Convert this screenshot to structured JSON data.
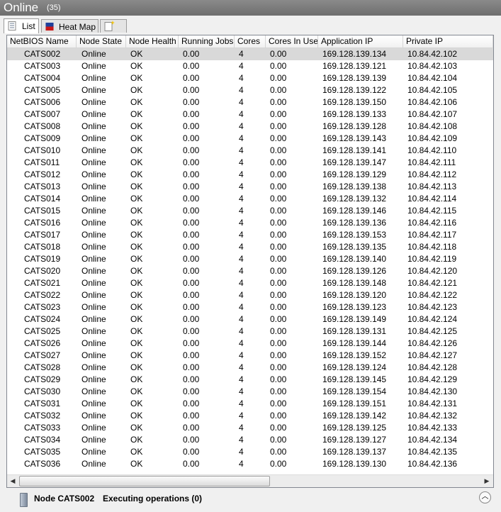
{
  "title": "Online",
  "count": "(35)",
  "tabs": [
    {
      "label": "List",
      "icon": "list-icon"
    },
    {
      "label": "Heat Map",
      "icon": "heatmap-icon"
    },
    {
      "label": "",
      "icon": "new-tab-icon"
    }
  ],
  "columns": [
    "NetBIOS Name",
    "Node State",
    "Node Health",
    "Running Jobs",
    "Cores",
    "Cores In Use",
    "Application IP",
    "Private IP"
  ],
  "rows": [
    [
      "CATS002",
      "Online",
      "OK",
      "0.00",
      "4",
      "0.00",
      "169.128.139.134",
      "10.84.42.102"
    ],
    [
      "CATS003",
      "Online",
      "OK",
      "0.00",
      "4",
      "0.00",
      "169.128.139.121",
      "10.84.42.103"
    ],
    [
      "CATS004",
      "Online",
      "OK",
      "0.00",
      "4",
      "0.00",
      "169.128.139.139",
      "10.84.42.104"
    ],
    [
      "CATS005",
      "Online",
      "OK",
      "0.00",
      "4",
      "0.00",
      "169.128.139.122",
      "10.84.42.105"
    ],
    [
      "CATS006",
      "Online",
      "OK",
      "0.00",
      "4",
      "0.00",
      "169.128.139.150",
      "10.84.42.106"
    ],
    [
      "CATS007",
      "Online",
      "OK",
      "0.00",
      "4",
      "0.00",
      "169.128.139.133",
      "10.84.42.107"
    ],
    [
      "CATS008",
      "Online",
      "OK",
      "0.00",
      "4",
      "0.00",
      "169.128.139.128",
      "10.84.42.108"
    ],
    [
      "CATS009",
      "Online",
      "OK",
      "0.00",
      "4",
      "0.00",
      "169.128.139.143",
      "10.84.42.109"
    ],
    [
      "CATS010",
      "Online",
      "OK",
      "0.00",
      "4",
      "0.00",
      "169.128.139.141",
      "10.84.42.110"
    ],
    [
      "CATS011",
      "Online",
      "OK",
      "0.00",
      "4",
      "0.00",
      "169.128.139.147",
      "10.84.42.111"
    ],
    [
      "CATS012",
      "Online",
      "OK",
      "0.00",
      "4",
      "0.00",
      "169.128.139.129",
      "10.84.42.112"
    ],
    [
      "CATS013",
      "Online",
      "OK",
      "0.00",
      "4",
      "0.00",
      "169.128.139.138",
      "10.84.42.113"
    ],
    [
      "CATS014",
      "Online",
      "OK",
      "0.00",
      "4",
      "0.00",
      "169.128.139.132",
      "10.84.42.114"
    ],
    [
      "CATS015",
      "Online",
      "OK",
      "0.00",
      "4",
      "0.00",
      "169.128.139.146",
      "10.84.42.115"
    ],
    [
      "CATS016",
      "Online",
      "OK",
      "0.00",
      "4",
      "0.00",
      "169.128.139.136",
      "10.84.42.116"
    ],
    [
      "CATS017",
      "Online",
      "OK",
      "0.00",
      "4",
      "0.00",
      "169.128.139.153",
      "10.84.42.117"
    ],
    [
      "CATS018",
      "Online",
      "OK",
      "0.00",
      "4",
      "0.00",
      "169.128.139.135",
      "10.84.42.118"
    ],
    [
      "CATS019",
      "Online",
      "OK",
      "0.00",
      "4",
      "0.00",
      "169.128.139.140",
      "10.84.42.119"
    ],
    [
      "CATS020",
      "Online",
      "OK",
      "0.00",
      "4",
      "0.00",
      "169.128.139.126",
      "10.84.42.120"
    ],
    [
      "CATS021",
      "Online",
      "OK",
      "0.00",
      "4",
      "0.00",
      "169.128.139.148",
      "10.84.42.121"
    ],
    [
      "CATS022",
      "Online",
      "OK",
      "0.00",
      "4",
      "0.00",
      "169.128.139.120",
      "10.84.42.122"
    ],
    [
      "CATS023",
      "Online",
      "OK",
      "0.00",
      "4",
      "0.00",
      "169.128.139.123",
      "10.84.42.123"
    ],
    [
      "CATS024",
      "Online",
      "OK",
      "0.00",
      "4",
      "0.00",
      "169.128.139.149",
      "10.84.42.124"
    ],
    [
      "CATS025",
      "Online",
      "OK",
      "0.00",
      "4",
      "0.00",
      "169.128.139.131",
      "10.84.42.125"
    ],
    [
      "CATS026",
      "Online",
      "OK",
      "0.00",
      "4",
      "0.00",
      "169.128.139.144",
      "10.84.42.126"
    ],
    [
      "CATS027",
      "Online",
      "OK",
      "0.00",
      "4",
      "0.00",
      "169.128.139.152",
      "10.84.42.127"
    ],
    [
      "CATS028",
      "Online",
      "OK",
      "0.00",
      "4",
      "0.00",
      "169.128.139.124",
      "10.84.42.128"
    ],
    [
      "CATS029",
      "Online",
      "OK",
      "0.00",
      "4",
      "0.00",
      "169.128.139.145",
      "10.84.42.129"
    ],
    [
      "CATS030",
      "Online",
      "OK",
      "0.00",
      "4",
      "0.00",
      "169.128.139.154",
      "10.84.42.130"
    ],
    [
      "CATS031",
      "Online",
      "OK",
      "0.00",
      "4",
      "0.00",
      "169.128.139.151",
      "10.84.42.131"
    ],
    [
      "CATS032",
      "Online",
      "OK",
      "0.00",
      "4",
      "0.00",
      "169.128.139.142",
      "10.84.42.132"
    ],
    [
      "CATS033",
      "Online",
      "OK",
      "0.00",
      "4",
      "0.00",
      "169.128.139.125",
      "10.84.42.133"
    ],
    [
      "CATS034",
      "Online",
      "OK",
      "0.00",
      "4",
      "0.00",
      "169.128.139.127",
      "10.84.42.134"
    ],
    [
      "CATS035",
      "Online",
      "OK",
      "0.00",
      "4",
      "0.00",
      "169.128.139.137",
      "10.84.42.135"
    ],
    [
      "CATS036",
      "Online",
      "OK",
      "0.00",
      "4",
      "0.00",
      "169.128.139.130",
      "10.84.42.136"
    ]
  ],
  "selected_row": 0,
  "status": {
    "node_label": "Node CATS002",
    "ops_label": "Executing operations (0)",
    "icon": "server-icon",
    "collapse_icon": "chevron-up-icon"
  },
  "colors": {
    "titlebar": "#7a7a7a",
    "selected_row": "#d9d9d9"
  }
}
